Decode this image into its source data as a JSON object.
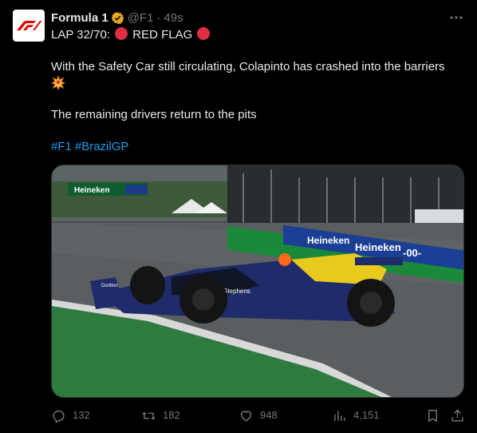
{
  "author": {
    "name": "Formula 1",
    "handle": "@F1",
    "separator": "·",
    "time": "49s",
    "avatar_logo": "F1",
    "accent": "#e10600",
    "verified_color": "#e8a71f"
  },
  "tweet": {
    "lap_prefix": "LAP 32/70:",
    "flag_text": "RED FLAG",
    "line2": "With the Safety Car still circulating, Colapinto has crashed into the barriers",
    "line3": "The remaining drivers return to the pits",
    "hashtags": [
      "#F1",
      "#BrazilGP"
    ],
    "emoji_flag_icon": "red-circle-icon",
    "emoji_crash_icon": "collision-icon"
  },
  "media": {
    "banner_1": "Heineken",
    "banner_2": "Heineken",
    "banner_3": "Heineken",
    "banner_zero": "-00-",
    "car_sponsor": "Stephens",
    "car_sponsor2": "Dorilton"
  },
  "actions": {
    "replies": "132",
    "reposts": "182",
    "likes": "948",
    "views": "4,151"
  },
  "colors": {
    "text": "#e7e9ea",
    "muted": "#71767b",
    "link": "#1d9bf0",
    "red_flag": "#dd2e44"
  }
}
